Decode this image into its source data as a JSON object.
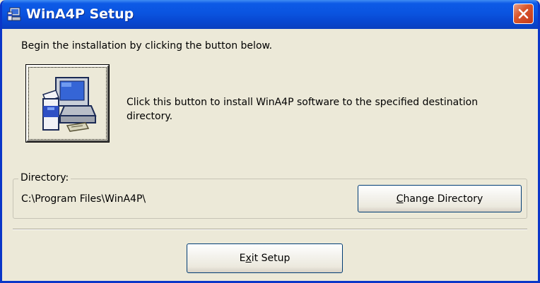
{
  "window": {
    "title": "WinA4P Setup"
  },
  "main": {
    "instructions": "Begin the installation by clicking the button below.",
    "install_description": "Click this button to install WinA4P software to the specified destination directory.",
    "directory_group": {
      "label": "Directory:",
      "path": "C:\\Program Files\\WinA4P\\"
    },
    "buttons": {
      "change_directory": {
        "accel": "C",
        "rest": "hange Directory"
      },
      "exit_setup": {
        "before": "E",
        "accel": "x",
        "after": "it Setup"
      }
    }
  },
  "icons": {
    "app": "setup-icon",
    "close": "close-icon",
    "install": "computer-install-icon"
  },
  "colors": {
    "titlebar": "#0a54e0",
    "window_bg": "#ece9d8",
    "close_button": "#d9572c"
  }
}
